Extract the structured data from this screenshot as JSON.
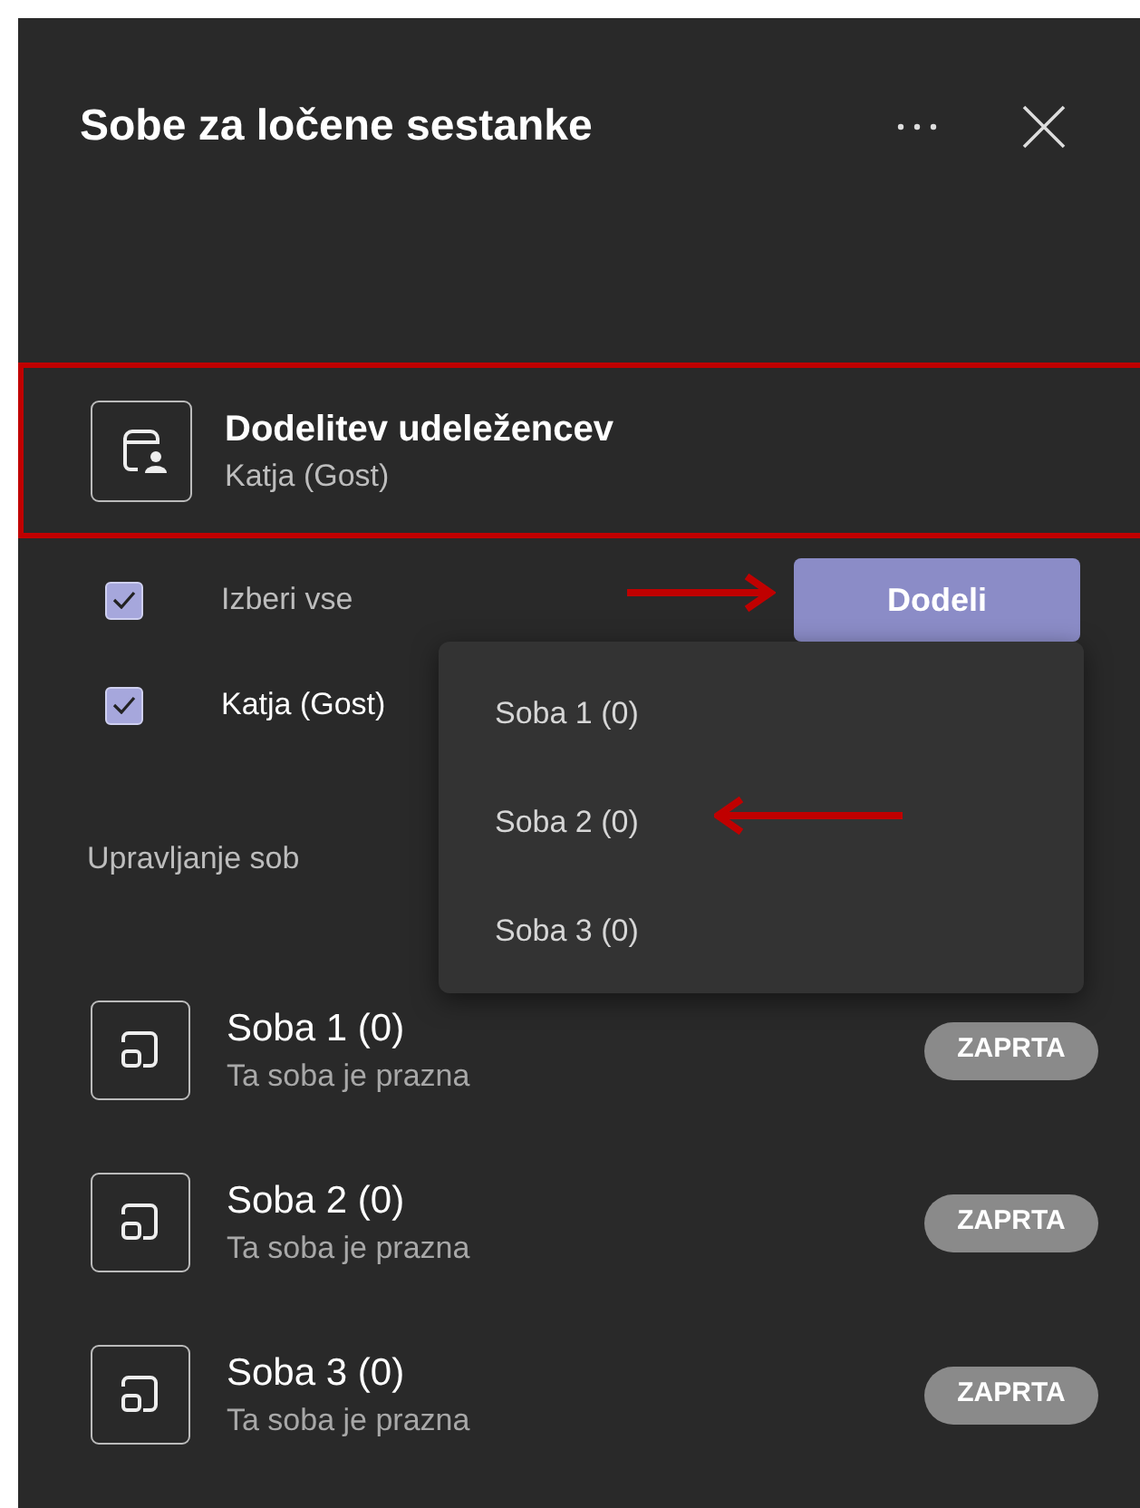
{
  "panel": {
    "title": "Sobe za ločene sestanke"
  },
  "assignment": {
    "title": "Dodelitev udeležencev",
    "subtitle": "Katja (Gost)",
    "highlighted": true
  },
  "select_all": {
    "label": "Izberi vse",
    "checked": true
  },
  "participants": [
    {
      "name": "Katja (Gost)",
      "checked": true
    }
  ],
  "assign_button": {
    "label": "Dodeli"
  },
  "assign_menu": {
    "items": [
      {
        "label": "Soba 1 (0)"
      },
      {
        "label": "Soba 2 (0)"
      },
      {
        "label": "Soba 3 (0)"
      }
    ]
  },
  "section_label": "Upravljanje sob",
  "rooms": [
    {
      "name": "Soba 1 (0)",
      "status": "Ta soba je prazna",
      "badge": "ZAPRTA"
    },
    {
      "name": "Soba 2 (0)",
      "status": "Ta soba je prazna",
      "badge": "ZAPRTA"
    },
    {
      "name": "Soba 3 (0)",
      "status": "Ta soba je prazna",
      "badge": "ZAPRTA"
    }
  ]
}
